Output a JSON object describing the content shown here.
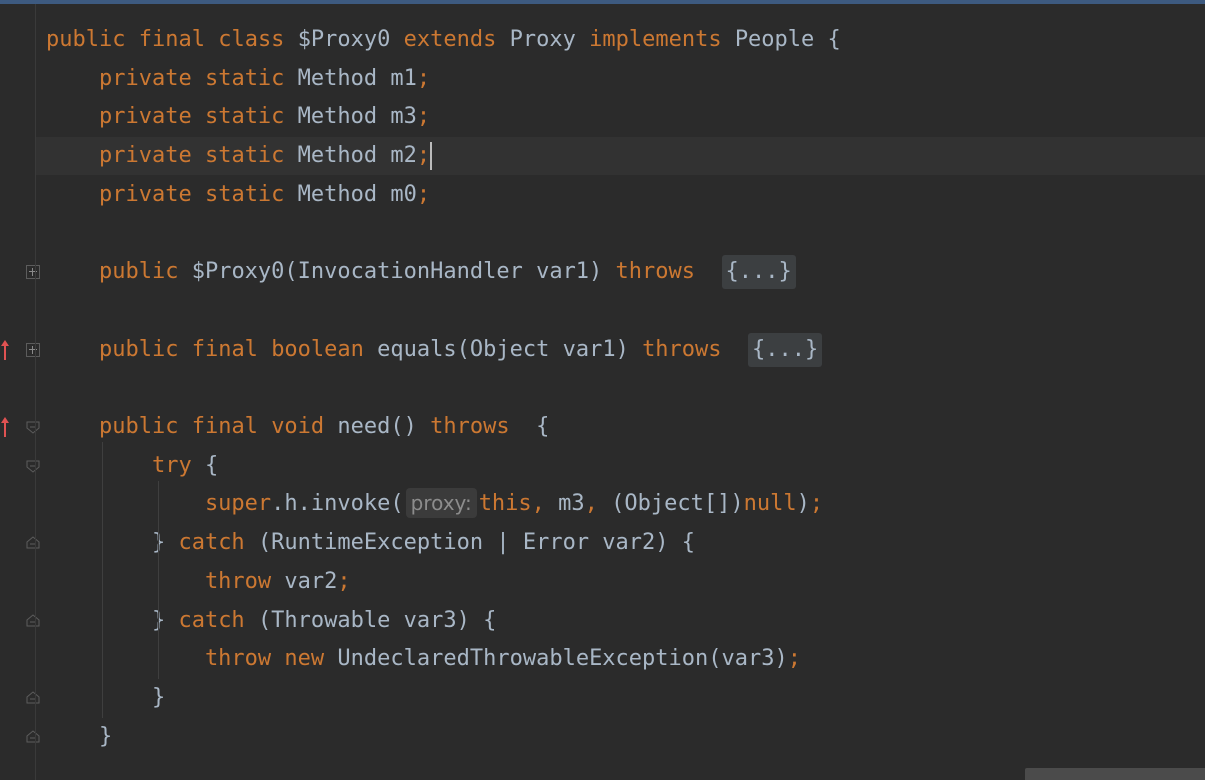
{
  "editor": {
    "lines": [
      {
        "tokens": [
          {
            "t": "public ",
            "c": "kw"
          },
          {
            "t": "final ",
            "c": "kw"
          },
          {
            "t": "class ",
            "c": "kw"
          },
          {
            "t": "$Proxy0 ",
            "c": "pl"
          },
          {
            "t": "extends ",
            "c": "kw"
          },
          {
            "t": "Proxy ",
            "c": "pl"
          },
          {
            "t": "implements ",
            "c": "kw"
          },
          {
            "t": "People {",
            "c": "pl"
          }
        ]
      },
      {
        "tokens": [
          {
            "t": "    private ",
            "c": "kw"
          },
          {
            "t": "static ",
            "c": "kw"
          },
          {
            "t": "Method m1",
            "c": "pl"
          },
          {
            "t": ";",
            "c": "kw"
          }
        ]
      },
      {
        "tokens": [
          {
            "t": "    private ",
            "c": "kw"
          },
          {
            "t": "static ",
            "c": "kw"
          },
          {
            "t": "Method m3",
            "c": "pl"
          },
          {
            "t": ";",
            "c": "kw"
          }
        ]
      },
      {
        "current": true,
        "caret": true,
        "tokens": [
          {
            "t": "    private ",
            "c": "kw"
          },
          {
            "t": "static ",
            "c": "kw"
          },
          {
            "t": "Method m2",
            "c": "pl"
          },
          {
            "t": ";",
            "c": "kw"
          }
        ]
      },
      {
        "tokens": [
          {
            "t": "    private ",
            "c": "kw"
          },
          {
            "t": "static ",
            "c": "kw"
          },
          {
            "t": "Method m0",
            "c": "pl"
          },
          {
            "t": ";",
            "c": "kw"
          }
        ]
      },
      {
        "tokens": []
      },
      {
        "tokens": [
          {
            "t": "    public ",
            "c": "kw"
          },
          {
            "t": "$Proxy0(InvocationHandler var1) ",
            "c": "pl"
          },
          {
            "t": "throws ",
            "c": "kw"
          },
          {
            "t": " ",
            "c": "pl"
          },
          {
            "t": "{...}",
            "c": "fold"
          }
        ]
      },
      {
        "tokens": []
      },
      {
        "tokens": [
          {
            "t": "    public ",
            "c": "kw"
          },
          {
            "t": "final ",
            "c": "kw"
          },
          {
            "t": "boolean ",
            "c": "kw"
          },
          {
            "t": "equals(Object var1) ",
            "c": "pl"
          },
          {
            "t": "throws ",
            "c": "kw"
          },
          {
            "t": " ",
            "c": "pl"
          },
          {
            "t": "{...}",
            "c": "fold"
          }
        ]
      },
      {
        "tokens": []
      },
      {
        "tokens": [
          {
            "t": "    public ",
            "c": "kw"
          },
          {
            "t": "final ",
            "c": "kw"
          },
          {
            "t": "void ",
            "c": "kw"
          },
          {
            "t": "need() ",
            "c": "pl"
          },
          {
            "t": "throws ",
            "c": "kw"
          },
          {
            "t": " {",
            "c": "pl"
          }
        ]
      },
      {
        "tokens": [
          {
            "t": "        try ",
            "c": "kw"
          },
          {
            "t": "{",
            "c": "pl"
          }
        ]
      },
      {
        "tokens": [
          {
            "t": "            super",
            "c": "kw"
          },
          {
            "t": ".h.invoke(",
            "c": "pl"
          },
          {
            "t": "proxy:",
            "c": "hint"
          },
          {
            "t": "this",
            "c": "kw"
          },
          {
            "t": ", ",
            "c": "kw"
          },
          {
            "t": "m3",
            "c": "pl"
          },
          {
            "t": ", ",
            "c": "kw"
          },
          {
            "t": "(Object[])",
            "c": "pl"
          },
          {
            "t": "null",
            "c": "kw"
          },
          {
            "t": ")",
            "c": "pl"
          },
          {
            "t": ";",
            "c": "kw"
          }
        ]
      },
      {
        "tokens": [
          {
            "t": "        } ",
            "c": "pl"
          },
          {
            "t": "catch ",
            "c": "kw"
          },
          {
            "t": "(RuntimeException | Error var2) {",
            "c": "pl"
          }
        ]
      },
      {
        "tokens": [
          {
            "t": "            throw ",
            "c": "kw"
          },
          {
            "t": "var2",
            "c": "pl"
          },
          {
            "t": ";",
            "c": "kw"
          }
        ]
      },
      {
        "tokens": [
          {
            "t": "        } ",
            "c": "pl"
          },
          {
            "t": "catch ",
            "c": "kw"
          },
          {
            "t": "(Throwable var3) {",
            "c": "pl"
          }
        ]
      },
      {
        "tokens": [
          {
            "t": "            throw ",
            "c": "kw"
          },
          {
            "t": "new ",
            "c": "kw"
          },
          {
            "t": "UndeclaredThrowableException(var3)",
            "c": "pl"
          },
          {
            "t": ";",
            "c": "kw"
          }
        ]
      },
      {
        "tokens": [
          {
            "t": "        }",
            "c": "pl"
          }
        ]
      },
      {
        "tokens": [
          {
            "t": "    }",
            "c": "pl"
          }
        ]
      }
    ]
  },
  "gutter": {
    "markers": [
      {
        "line": 6,
        "type": "fold-collapsed-icon"
      },
      {
        "line": 8,
        "type": "fold-collapsed-icon",
        "override": true
      },
      {
        "line": 10,
        "type": "fold-expanded-icon",
        "override": true
      },
      {
        "line": 11,
        "type": "fold-expanded-icon"
      },
      {
        "line": 13,
        "type": "fold-end-icon"
      },
      {
        "line": 15,
        "type": "fold-end-icon"
      },
      {
        "line": 17,
        "type": "fold-end-icon"
      },
      {
        "line": 18,
        "type": "fold-end-icon"
      }
    ]
  },
  "colors": {
    "background": "#2b2b2b",
    "keyword": "#cc7832",
    "plain": "#a9b7c6",
    "current_line": "#323232",
    "override_arrow": "#e05252"
  }
}
